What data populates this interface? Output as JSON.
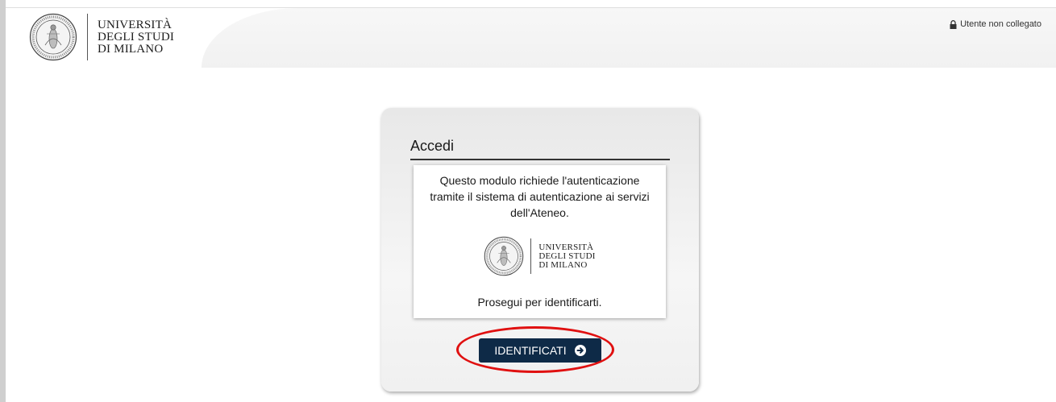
{
  "header": {
    "logo": {
      "line1": "UNIVERSITÀ",
      "line2": "DEGLI STUDI",
      "line3": "DI MILANO"
    },
    "user_status": "Utente non collegato",
    "user_status_icon": "lock-icon"
  },
  "login_panel": {
    "title": "Accedi",
    "message": "Questo modulo richiede l'autenticazione tramite il sistema di autenticazione ai servizi dell'Ateneo.",
    "logo": {
      "line1": "UNIVERSITÀ",
      "line2": "DEGLI STUDI",
      "line3": "DI MILANO"
    },
    "continue_text": "Prosegui per identificarti.",
    "button_label": "IDENTIFICATI",
    "button_icon": "arrow-circle-right-icon"
  },
  "colors": {
    "button_bg": "#0e2a47",
    "highlight": "#e01010"
  }
}
